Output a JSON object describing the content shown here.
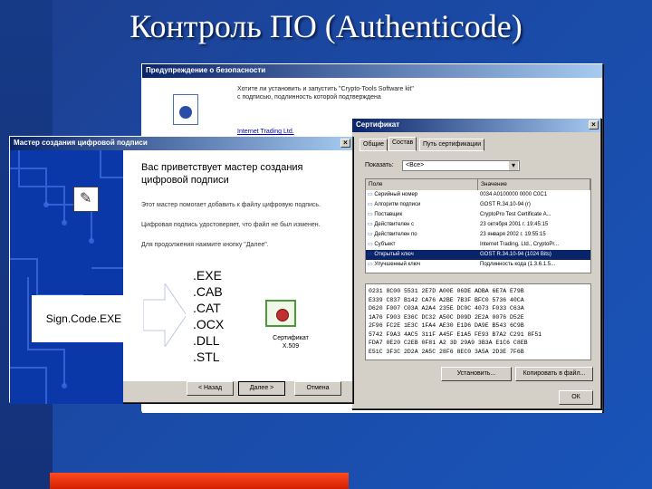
{
  "slide": {
    "title": "Контроль ПО (Authenticode)"
  },
  "security_window": {
    "title": "Предупреждение о безопасности",
    "message": "Хотите ли установить и запустить \"Crypto-Tools Software kit\" с подписью, подлинность которой подтверждена",
    "link": "Internet Trading Ltd."
  },
  "wizard": {
    "title": "Мастер создания цифровой подписи",
    "heading": "Вас приветствует мастер создания цифровой подписи",
    "para1": "Этот мастер помогает добавить к файлу цифровую подпись.",
    "para2": "Цифровая подпись удостоверяет, что файл не был изменен.",
    "para3": "Для продолжения нажмите кнопку \"Далее\".",
    "back_button": "< Назад",
    "next_button": "Далее >",
    "cancel_button": "Отмена"
  },
  "signcode": {
    "label": "Sign.Code.EXE"
  },
  "file_types": [
    ".EXE",
    ".CAB",
    ".CAT",
    ".OCX",
    ".DLL",
    ".STL"
  ],
  "certificate_icon": {
    "line1": "Сертификат",
    "line2": "X.509"
  },
  "cert_window": {
    "title": "Сертификат",
    "tabs": [
      "Общие",
      "Состав",
      "Путь сертификации"
    ],
    "show_label": "Показать:",
    "show_value": "<Все>",
    "columns": [
      "Поле",
      "Значение"
    ],
    "rows": [
      {
        "field": "Серийный номер",
        "value": "0034 A0100000 0000 C0C1"
      },
      {
        "field": "Алгоритм подписи",
        "value": "GOST R.34.10-94 (r)"
      },
      {
        "field": "Поставщик",
        "value": "CryptoPro Test Certificate A..."
      },
      {
        "field": "Действителен с",
        "value": "23 октября 2001 г. 19:45:15"
      },
      {
        "field": "Действителен по",
        "value": "23 января 2002 г. 19:55:15"
      },
      {
        "field": "Субъект",
        "value": "Internet Trading, Ltd., CryptoPr..."
      },
      {
        "field": "Открытый ключ",
        "value": "GOST R.34.10-94 (1024 Bits)",
        "selected": true
      },
      {
        "field": "Улучшенный ключ",
        "value": "Подлинность кода (1.3.6.1.5..."
      }
    ],
    "hex_lines": [
      "0231 8C00 5531 2E7D A00E 06DE ADBA 6E7A E79B",
      "E339 C837 B142 CA76 A2BE 7B3F BFC0 5736 40CA",
      "D620 F007 C03A A2A4 235E DC0C 4073 F033 C63A",
      "1A76 F903 E36C DC32 A50C D09D 2E2A 0076 D52E",
      "2F96 FC2E 1E3C 1FA4 AE30 E1D6 DA9E B543 6C9B",
      "5742 F9A3 4AC5 311F A45F E1A5 FE93 B7A2 C291 8F51",
      "FDA7 0E20 C2EB 0F81 A2 3D 29A9 3B3A E1C6 C8EB",
      "E51C 3F3C 2D2A 2A5C 28F6 8EC0 3A5A 2D3E 7F6B"
    ],
    "install_button": "Установить...",
    "copy_button": "Копировать в файл...",
    "ok_button": "ОК"
  }
}
